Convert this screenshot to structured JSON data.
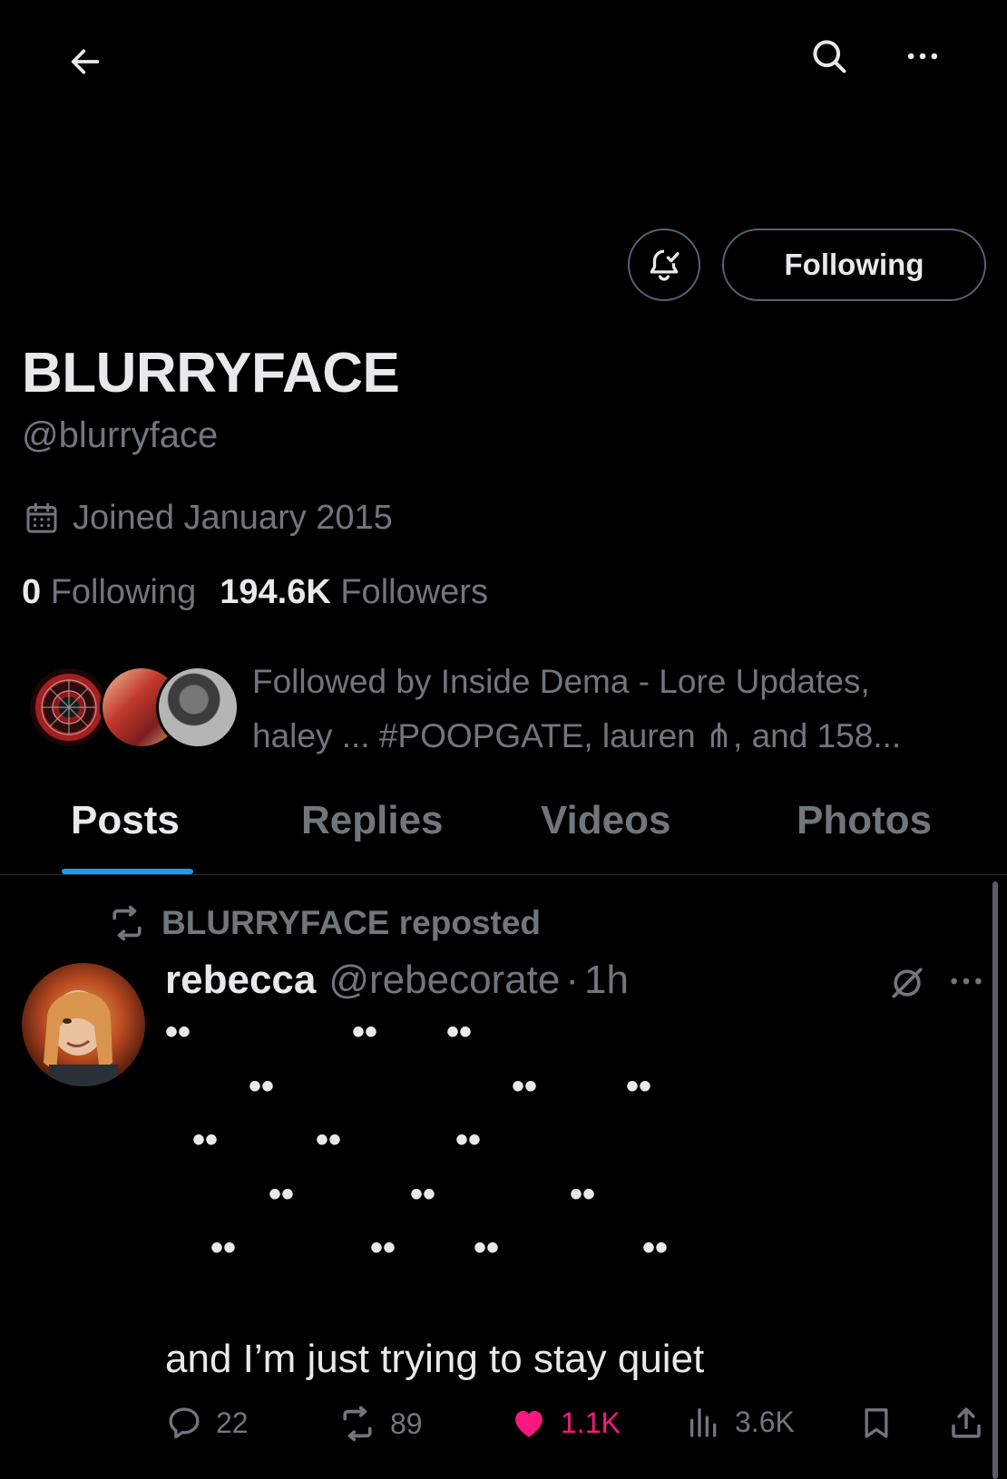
{
  "topbar": {
    "back_icon": "arrow-left-icon",
    "search_icon": "search-icon",
    "more_icon": "more-horizontal-icon"
  },
  "header": {
    "notify_icon": "bell-check-icon",
    "following_label": "Following"
  },
  "profile": {
    "display_name": "BLURRYFACE",
    "handle": "@blurryface",
    "joined": "Joined January 2015",
    "following_count": "0",
    "following_label": "Following",
    "followers_count": "194.6K",
    "followers_label": "Followers",
    "followed_by_line1": "Followed by Inside Dema - Lore Updates,",
    "followed_by_line2": "haley ... #POOPGATE, lauren ⋔, and 158..."
  },
  "tabs": [
    {
      "label": "Posts",
      "active": true
    },
    {
      "label": "Replies",
      "active": false
    },
    {
      "label": "Videos",
      "active": false
    },
    {
      "label": "Photos",
      "active": false
    }
  ],
  "post": {
    "repost_label": "BLURRYFACE reposted",
    "author_name": "rebecca",
    "author_handle": "@rebecorate",
    "separator": "·",
    "time": "1h",
    "dots": "••",
    "text": "and I’m just trying to stay quiet",
    "replies": "22",
    "reposts": "89",
    "likes": "1.1K",
    "views": "3.6K"
  },
  "colors": {
    "accent": "#1d9bf0",
    "like": "#f91880",
    "muted": "#71767b",
    "text": "#e7e9ea"
  }
}
